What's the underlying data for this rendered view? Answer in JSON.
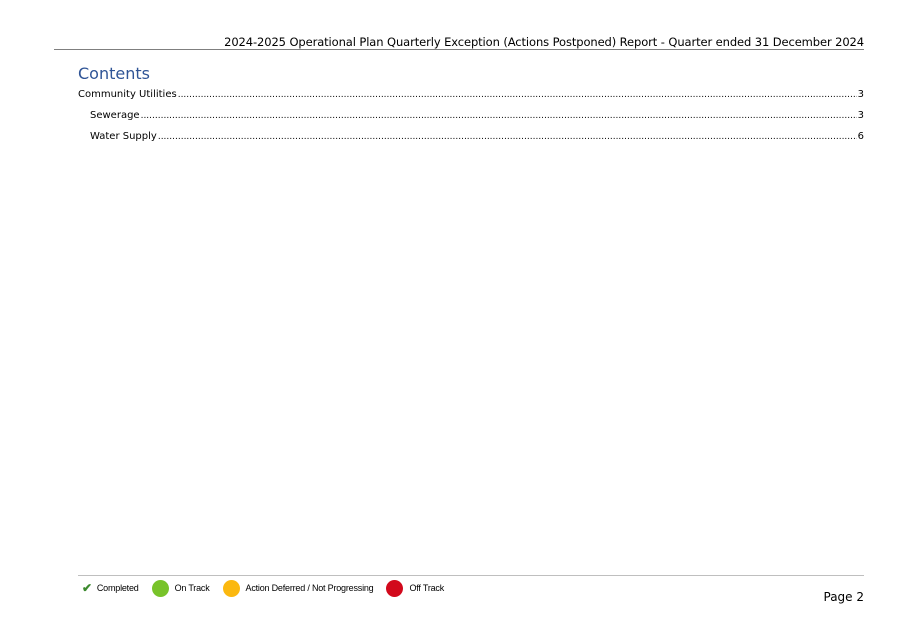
{
  "header": {
    "title": "2024-2025 Operational Plan Quarterly Exception (Actions Postponed) Report - Quarter ended 31 December 2024"
  },
  "toc": {
    "heading": "Contents",
    "entries": [
      {
        "label": "Community Utilities",
        "page": "3"
      },
      {
        "label": "Sewerage",
        "page": "3"
      },
      {
        "label": "Water Supply",
        "page": "6"
      }
    ]
  },
  "legend": {
    "completed": "Completed",
    "on_track": "On Track",
    "deferred": "Action Deferred / Not Progressing",
    "off_track": "Off Track",
    "colors": {
      "completed": "#3c8a2e",
      "on_track": "#78c32a",
      "deferred": "#fbb80f",
      "off_track": "#d2091c",
      "heading": "#2f5496"
    },
    "icons": {
      "completed": "check-icon",
      "on_track": "green-circle-icon",
      "deferred": "amber-circle-icon",
      "off_track": "red-circle-icon"
    }
  },
  "footer": {
    "page_label": "Page 2"
  }
}
